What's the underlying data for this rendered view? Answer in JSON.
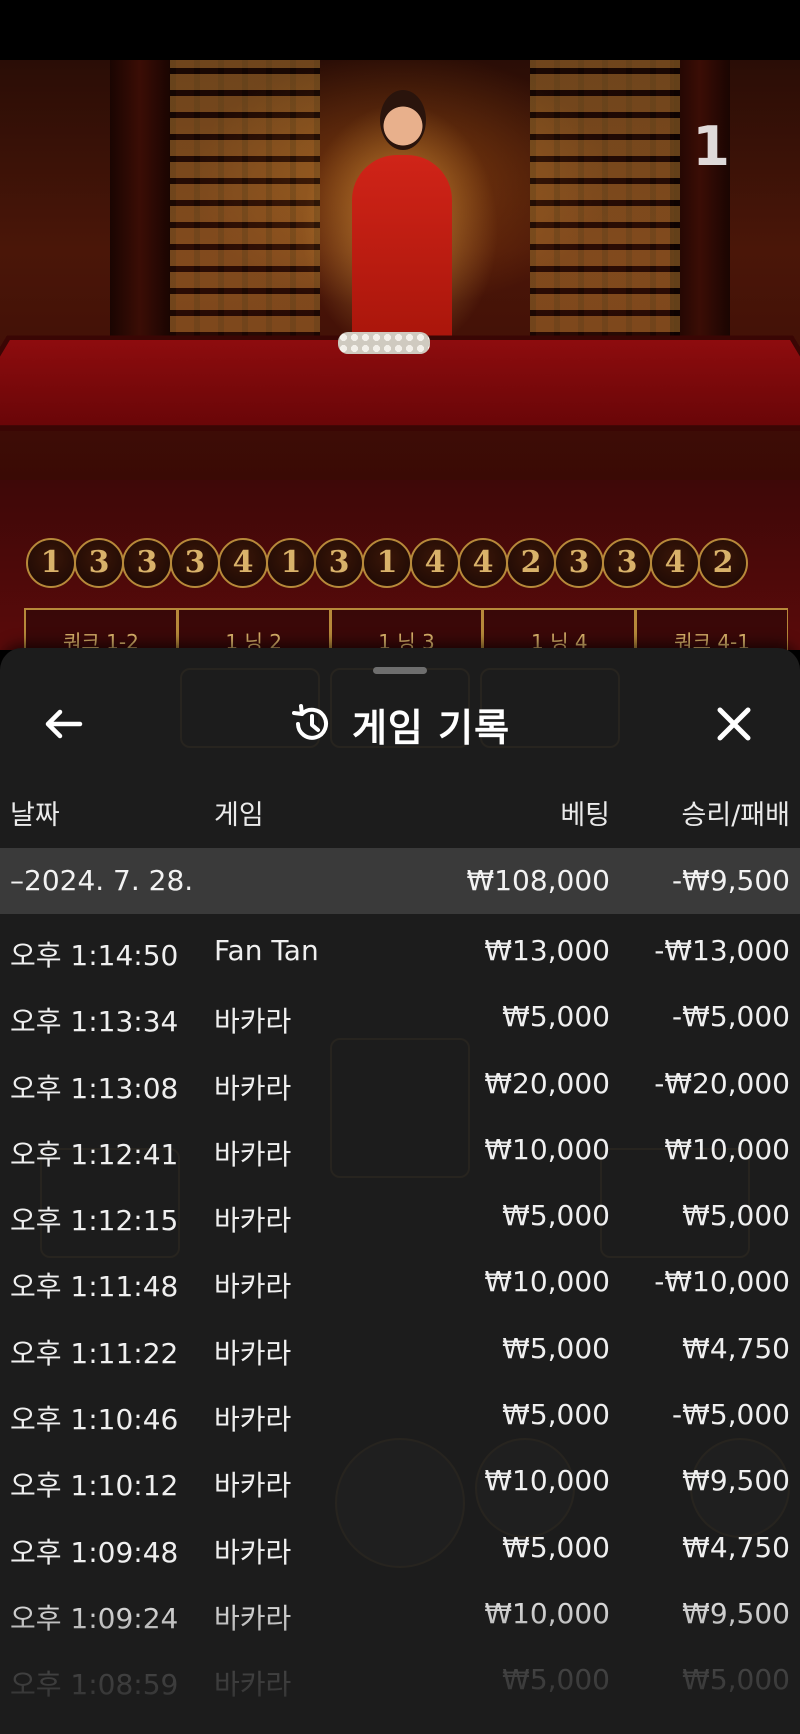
{
  "game_view": {
    "round_number": "1",
    "roadmap": [
      "1",
      "3",
      "3",
      "3",
      "4",
      "1",
      "3",
      "1",
      "4",
      "4",
      "2",
      "3",
      "3",
      "4",
      "2"
    ],
    "bet_spots": [
      "쿼크 1-2",
      "1 닝 2",
      "1 닝 3",
      "1 닝 4",
      "쿼크 4-1"
    ]
  },
  "history": {
    "title": "게임 기록",
    "columns": {
      "date": "날짜",
      "game": "게임",
      "bet": "베팅",
      "win_loss": "승리/패배"
    },
    "date_group": {
      "label": "–2024. 7. 28.",
      "bet_total": "₩108,000",
      "win_loss_total": "-₩9,500"
    },
    "rows": [
      {
        "time": "오후 1:14:50",
        "game": "Fan Tan",
        "bet": "₩13,000",
        "result": "-₩13,000"
      },
      {
        "time": "오후 1:13:34",
        "game": "바카라",
        "bet": "₩5,000",
        "result": "-₩5,000"
      },
      {
        "time": "오후 1:13:08",
        "game": "바카라",
        "bet": "₩20,000",
        "result": "-₩20,000"
      },
      {
        "time": "오후 1:12:41",
        "game": "바카라",
        "bet": "₩10,000",
        "result": "₩10,000"
      },
      {
        "time": "오후 1:12:15",
        "game": "바카라",
        "bet": "₩5,000",
        "result": "₩5,000"
      },
      {
        "time": "오후 1:11:48",
        "game": "바카라",
        "bet": "₩10,000",
        "result": "-₩10,000"
      },
      {
        "time": "오후 1:11:22",
        "game": "바카라",
        "bet": "₩5,000",
        "result": "₩4,750"
      },
      {
        "time": "오후 1:10:46",
        "game": "바카라",
        "bet": "₩5,000",
        "result": "-₩5,000"
      },
      {
        "time": "오후 1:10:12",
        "game": "바카라",
        "bet": "₩10,000",
        "result": "₩9,500"
      },
      {
        "time": "오후 1:09:48",
        "game": "바카라",
        "bet": "₩5,000",
        "result": "₩4,750"
      },
      {
        "time": "오후 1:09:24",
        "game": "바카라",
        "bet": "₩10,000",
        "result": "₩9,500"
      },
      {
        "time": "오후 1:08:59",
        "game": "바카라",
        "bet": "₩5,000",
        "result": "₩5,000"
      }
    ]
  },
  "icons": {
    "back": "arrow-left-icon",
    "close": "close-icon",
    "history": "history-clock-icon"
  }
}
